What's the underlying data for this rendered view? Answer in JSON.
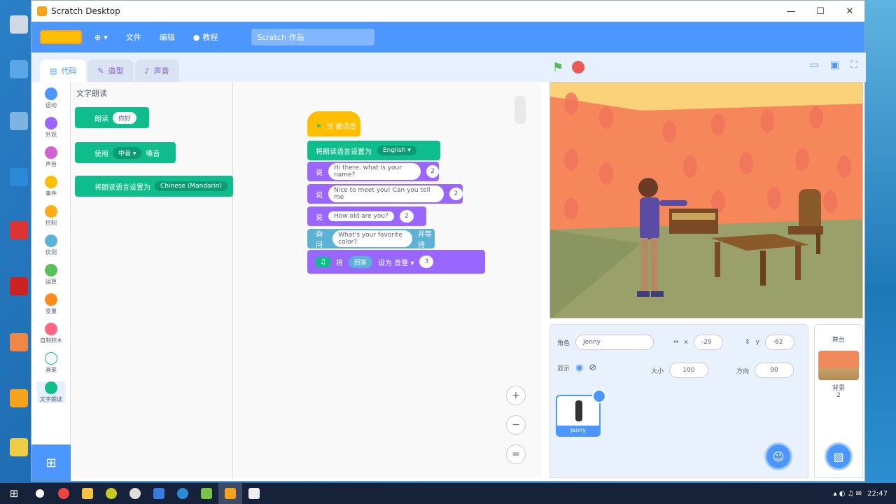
{
  "window": {
    "title": "Scratch Desktop",
    "controls": [
      "—",
      "☐",
      "✕"
    ]
  },
  "menubar": {
    "logo": "Scratch",
    "items": [
      "文件",
      "编辑"
    ],
    "tutorial": "教程",
    "project_title": "Scratch 作品"
  },
  "tabs": [
    {
      "label": "代码",
      "icon": "code-icon"
    },
    {
      "label": "造型",
      "icon": "brush-icon"
    },
    {
      "label": "声音",
      "icon": "sound-icon"
    }
  ],
  "categories": [
    {
      "label": "运动",
      "color": "#4c97ff"
    },
    {
      "label": "外观",
      "color": "#9966ff"
    },
    {
      "label": "声音",
      "color": "#cf63cf"
    },
    {
      "label": "事件",
      "color": "#ffbf00"
    },
    {
      "label": "控制",
      "color": "#ffab19"
    },
    {
      "label": "侦测",
      "color": "#5cb1d6"
    },
    {
      "label": "运算",
      "color": "#59c059"
    },
    {
      "label": "变量",
      "color": "#ff8c1a"
    },
    {
      "label": "自制积木",
      "color": "#ff6680"
    },
    {
      "label": "画笔",
      "color": "#0fbd8c"
    },
    {
      "label": "文字朗读",
      "color": "#0fbd8c"
    }
  ],
  "palette": {
    "title": "文字朗读",
    "blocks": [
      {
        "text": "朗读",
        "arg": "你好"
      },
      {
        "text": "使用",
        "arg": "中音 ▾",
        "suffix": "嗓音"
      },
      {
        "text": "将朗读语言设置为",
        "arg": "Chinese (Mandarin)"
      }
    ]
  },
  "script": {
    "hat": "当 被点击",
    "lines": [
      {
        "text": "将朗读语言设置为",
        "arg": "English ▾"
      },
      {
        "text": "说",
        "arg": "Hi there, what is your name?",
        "num": "2"
      },
      {
        "text": "说",
        "arg": "Nice to meet you! Can you tell me",
        "num": "2"
      },
      {
        "text": "说",
        "arg": "How old are you?",
        "num": "2"
      },
      {
        "text": "询问",
        "arg": "What's your favorite color?",
        "suffix": "并等待"
      },
      {
        "text": "将",
        "arg": "回答",
        "suffix": "设为 音量 ▾",
        "num": "3"
      }
    ]
  },
  "zoom": [
    "+",
    "−",
    "="
  ],
  "stage": {
    "sprite_label": "角色",
    "sprite_name": "Jenny",
    "x_label": "x",
    "x_value": "-29",
    "y_label": "y",
    "y_value": "-62",
    "show_label": "显示",
    "size_label": "大小",
    "size_value": "100",
    "direction_label": "方向",
    "direction_value": "90"
  },
  "sprites": [
    {
      "name": "Jenny"
    }
  ],
  "backdrop": {
    "title": "舞台",
    "label": "背景",
    "count": "2"
  },
  "taskbar": {
    "time": "22:47"
  }
}
